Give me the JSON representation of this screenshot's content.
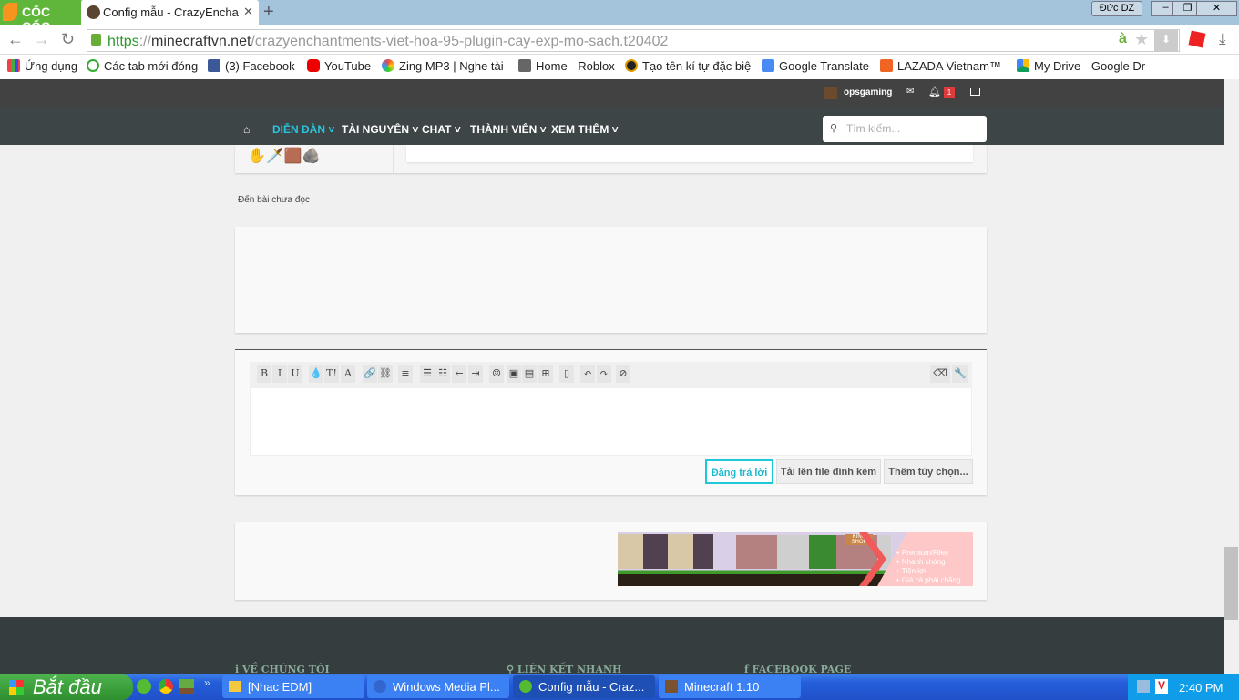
{
  "browser": {
    "brand": "CỐC CỐC",
    "tab_title": "Config mẫu - CrazyEncha",
    "profile": "Đức DZ",
    "url_scheme": "https",
    "url_host": "minecraftvn.net",
    "url_path": "/crazyenchantments-viet-hoa-95-plugin-cay-exp-mo-sach.t20402",
    "bookmarks": [
      "Ứng dụng",
      "Các tab mới đóng",
      "(3) Facebook",
      "YouTube",
      "Zing MP3 | Nghe tài",
      "Home - Roblox",
      "Tạo tên kí tự đặc biệ",
      "Google Translate",
      "LAZADA Vietnam™ -",
      "My Drive - Google Dr"
    ]
  },
  "site": {
    "username": "opsgaming",
    "notif_count": "1",
    "nav": [
      "DIỄN ĐÀN",
      "TÀI NGUYÊN",
      "CHAT",
      "THÀNH VIÊN",
      "XEM THÊM"
    ],
    "search_placeholder": "Tìm kiếm...",
    "unread_link": "Đến bài chưa đọc",
    "editor": {
      "tools": [
        "B",
        "I",
        "U",
        "💧",
        "T!",
        "A",
        "🔗",
        "⛓",
        "≡",
        "☰",
        "☷",
        "⇤",
        "⇥",
        "☺",
        "▣",
        "▤",
        "⊞",
        "▯",
        "↶",
        "↷",
        "⊘"
      ],
      "submit": "Đăng trả lời",
      "upload": "Tải lên file đính kèm",
      "more": "Thêm tùy chọn..."
    },
    "banner": {
      "shop": "KING SHOP",
      "lines": [
        "+ Premium/Files",
        "+ Nhanh chóng",
        "+ Tiện lợi",
        "+ Giá cả phải chăng"
      ]
    },
    "footer": [
      "VỀ CHÚNG TÔI",
      "LIÊN KẾT NHANH",
      "FACEBOOK PAGE"
    ]
  },
  "taskbar": {
    "start": "Bắt đầu",
    "tasks": [
      "[Nhac EDM]",
      "Windows Media Pl...",
      "Config mẫu - Craz...",
      "Minecraft 1.10"
    ],
    "clock": "2:40 PM"
  }
}
